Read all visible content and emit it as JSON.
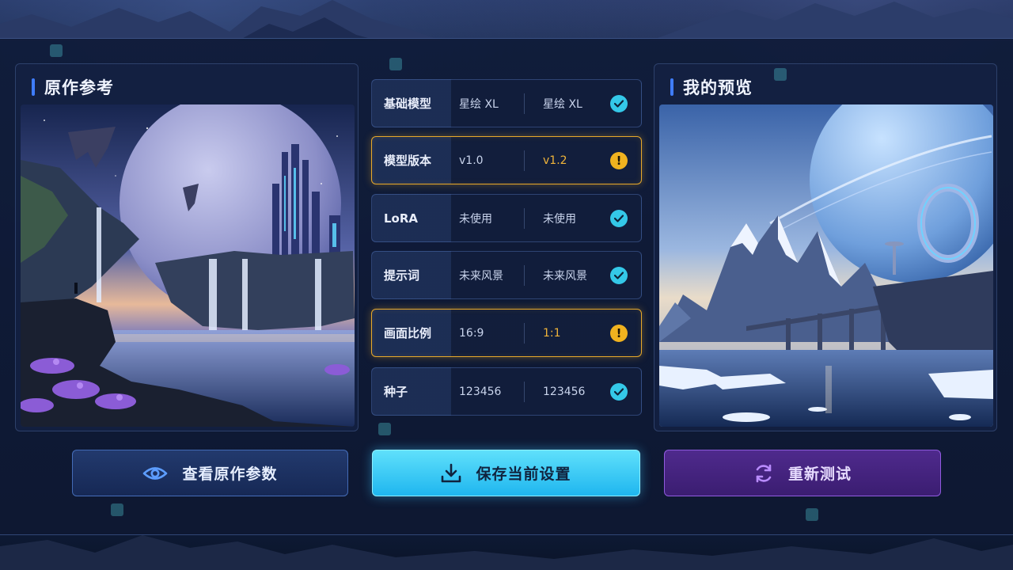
{
  "left_panel": {
    "title": "原作参考"
  },
  "right_panel": {
    "title": "我的预览"
  },
  "comparison": [
    {
      "label": "基础模型",
      "original": "星绘 XL",
      "mine": "星绘 XL",
      "status": "match"
    },
    {
      "label": "模型版本",
      "original": "v1.0",
      "mine": "v1.2",
      "status": "mismatch"
    },
    {
      "label": "LoRA",
      "original": "未使用",
      "mine": "未使用",
      "status": "match"
    },
    {
      "label": "提示词",
      "original": "未来风景",
      "mine": "未来风景",
      "status": "match"
    },
    {
      "label": "画面比例",
      "original": "16:9",
      "mine": "1:1",
      "status": "mismatch"
    },
    {
      "label": "种子",
      "original": "123456",
      "mine": "123456",
      "status": "match"
    }
  ],
  "buttons": {
    "view_params": "查看原作参数",
    "save_settings": "保存当前设置",
    "retest": "重新测试"
  },
  "icons": {
    "view_params": "eye-icon",
    "save_settings": "download-icon",
    "retest": "refresh-icon",
    "match": "check-circle-icon",
    "mismatch": "exclamation-circle-icon"
  },
  "colors": {
    "accent_blue": "#3f7dff",
    "match": "#34c8e8",
    "mismatch": "#f0b21f",
    "save_button": "#1fb6ef",
    "retest_button": "#5a2a9a"
  }
}
